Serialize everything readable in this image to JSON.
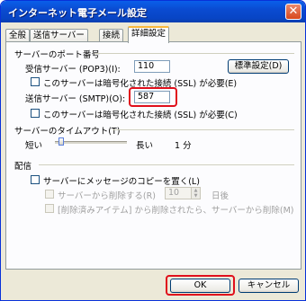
{
  "window": {
    "title": "インターネット電子メール設定",
    "close_glyph": "✕"
  },
  "tabs": [
    {
      "label": "全般"
    },
    {
      "label": "送信サーバー"
    },
    {
      "label": "接続"
    },
    {
      "label": "詳細設定"
    }
  ],
  "ports": {
    "section_title": "サーバーのポート番号",
    "incoming_label": "受信サーバー (POP3)(I):",
    "incoming_value": "110",
    "default_button": "標準設定(D)",
    "incoming_ssl_label": "このサーバーは暗号化された接続 (SSL) が必要(E)",
    "outgoing_label": "送信サーバー (SMTP)(O):",
    "outgoing_value": "587",
    "outgoing_ssl_label": "このサーバーは暗号化された接続 (SSL) が必要(C)"
  },
  "timeout": {
    "section_title": "サーバーのタイムアウト(T)",
    "short_label": "短い",
    "long_label": "長い",
    "value_text": "1 分",
    "level": 0.05
  },
  "delivery": {
    "section_title": "配信",
    "keep_copy_label": "サーバーにメッセージのコピーを置く(L)",
    "remove_after_label": "サーバーから削除する(R)",
    "days_value": "10",
    "days_unit": "日後",
    "remove_deleted_label": "[削除済みアイテム] から削除されたら、サーバーから削除(M)"
  },
  "buttons": {
    "ok": "OK",
    "cancel": "キャンセル"
  }
}
